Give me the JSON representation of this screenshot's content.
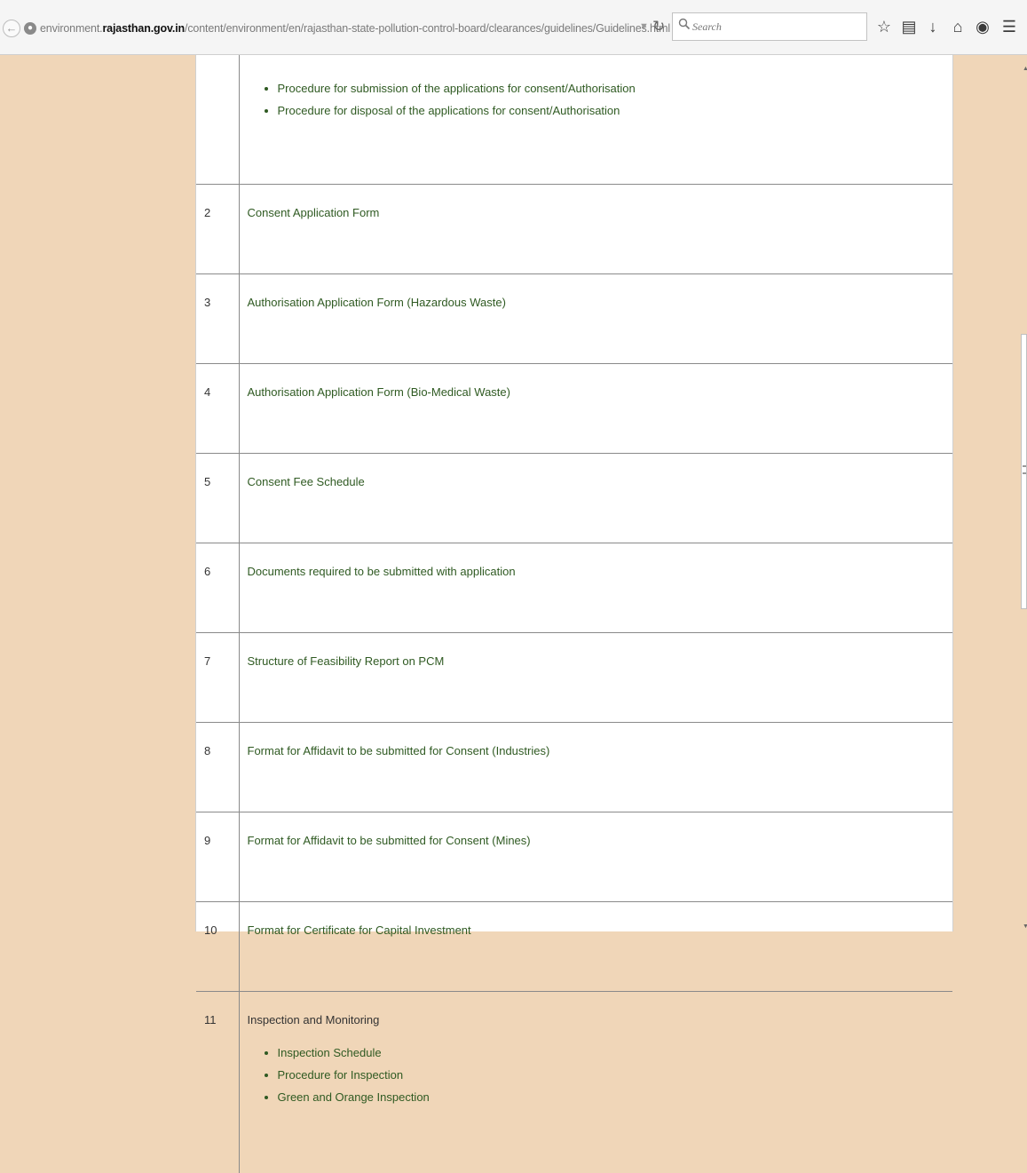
{
  "browser": {
    "url_prefix": "environment.",
    "url_domain": "rajasthan.gov.in",
    "url_path": "/content/environment/en/rajasthan-state-pollution-control-board/clearances/guidelines/Guidelines.html",
    "search_placeholder": "Search"
  },
  "table": {
    "top_items": [
      "Procedure for submission of the applications for consent/Authorisation",
      "Procedure for disposal of the applications for consent/Authorisation"
    ],
    "rows": [
      {
        "num": "2",
        "title": "Consent Application Form"
      },
      {
        "num": "3",
        "title": "Authorisation Application Form (Hazardous Waste)"
      },
      {
        "num": "4",
        "title": "Authorisation Application Form (Bio-Medical Waste)"
      },
      {
        "num": "5",
        "title": "Consent Fee Schedule"
      },
      {
        "num": "6",
        "title": "Documents required to be submitted with application"
      },
      {
        "num": "7",
        "title": "Structure of Feasibility Report on PCM"
      },
      {
        "num": "8",
        "title": "Format for Affidavit to be submitted for Consent (Industries)"
      },
      {
        "num": "9",
        "title": "Format for Affidavit to be submitted for Consent (Mines)"
      },
      {
        "num": "10",
        "title": "Format for Certificate for Capital Investment"
      }
    ],
    "last_row": {
      "num": "11",
      "title": "Inspection and Monitoring",
      "items": [
        "Inspection Schedule",
        "Procedure for Inspection",
        "Green and Orange Inspection"
      ]
    }
  }
}
